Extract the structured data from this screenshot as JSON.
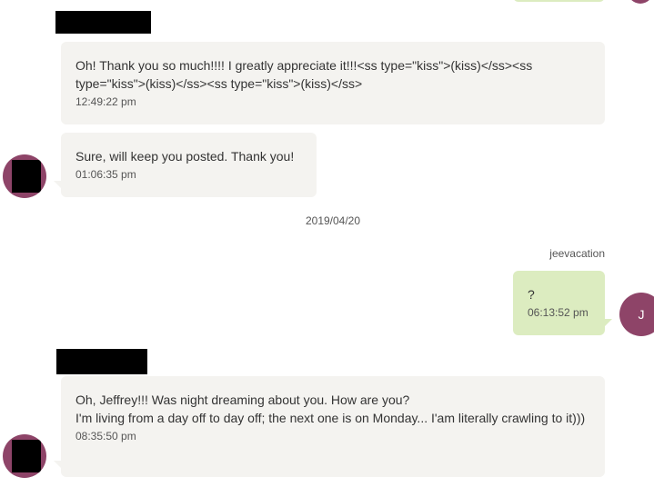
{
  "conversation": {
    "messages": [
      {
        "text": "Oh! Thank you so much!!!! I greatly appreciate it!!!<ss type=\"kiss\">(kiss)</ss><ss type=\"kiss\">(kiss)</ss><ss type=\"kiss\">(kiss)</ss>",
        "time": "12:49:22 pm"
      },
      {
        "text": "Sure, will keep you posted. Thank you!",
        "time": "01:06:35 pm"
      },
      {
        "date": "2019/04/20"
      },
      {
        "sender": "jeevacation",
        "avatar_initial": "J",
        "text": "?",
        "time": "06:13:52 pm"
      },
      {
        "text": "Oh, Jeffrey!!! Was night dreaming about you. How are you?\nI'm living from a day off to day off; the next one is on Monday... I'am literally crawling to it)))",
        "time": "08:35:50 pm"
      }
    ]
  },
  "colors": {
    "their_bubble": "#f4f3f0",
    "my_bubble": "#dcecc0",
    "avatar": "#8e4468",
    "meta_text": "#555555"
  }
}
